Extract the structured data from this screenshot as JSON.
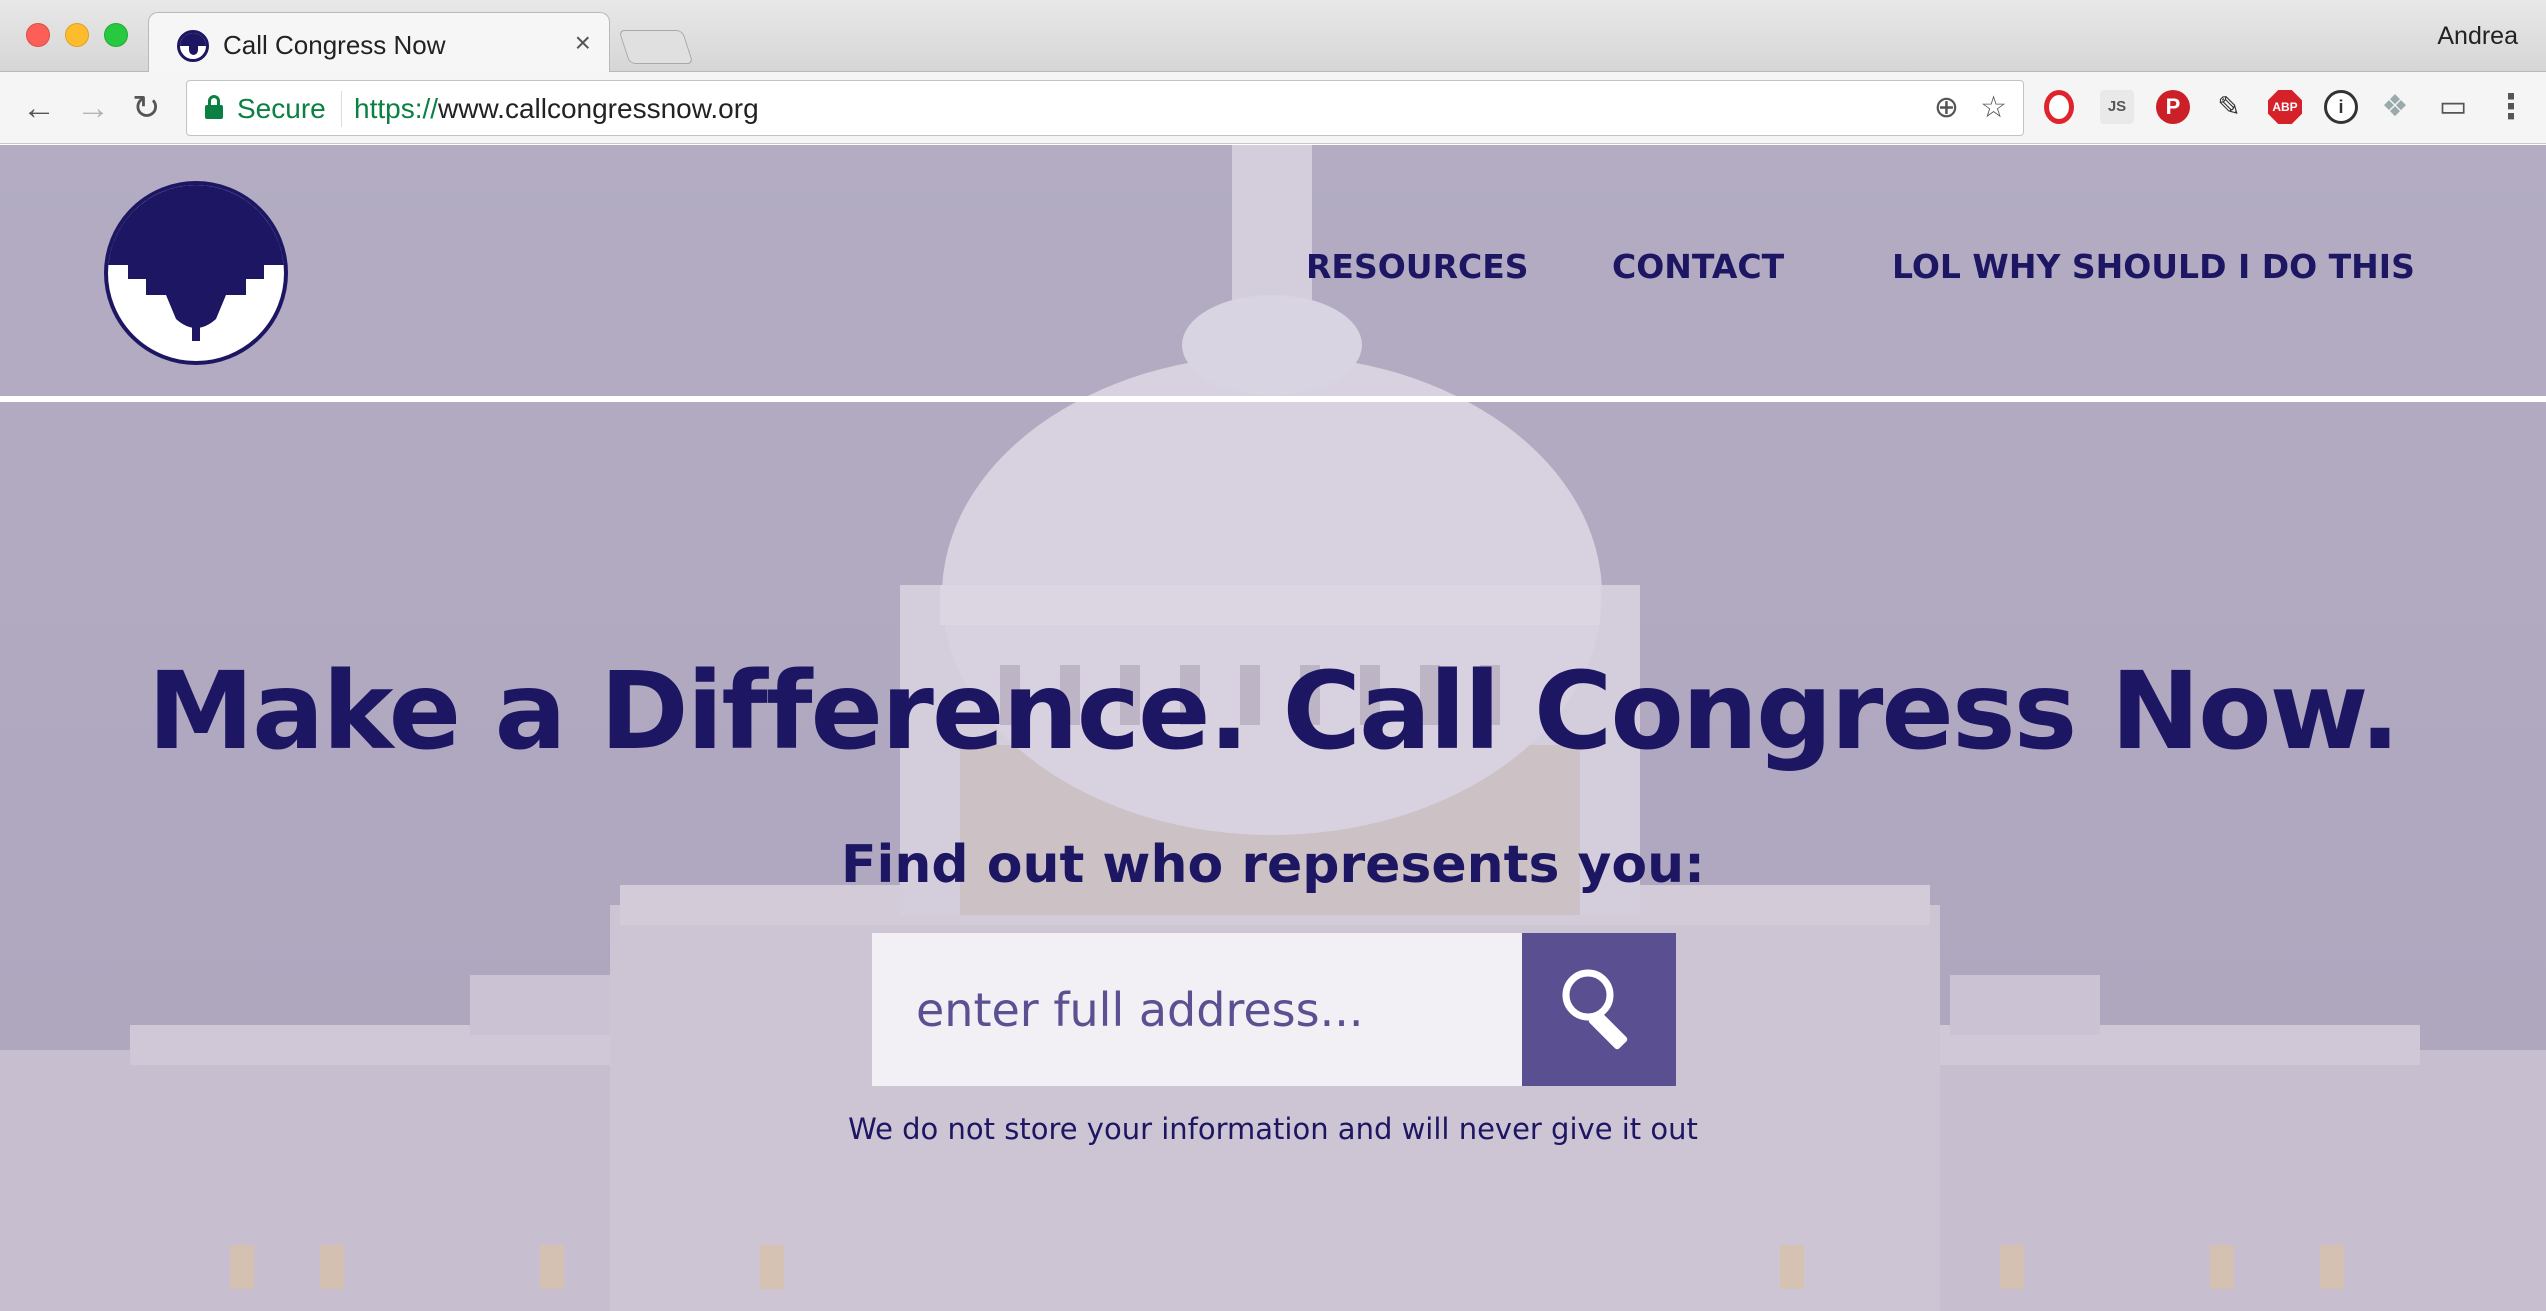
{
  "browser": {
    "tab_title": "Call Congress Now",
    "tab_close": "×",
    "profile_name": "Andrea",
    "secure_label": "Secure",
    "url_scheme": "https://",
    "url_rest": "www.callcongressnow.org",
    "icons": {
      "back": "back-arrow-icon",
      "forward": "forward-arrow-icon",
      "reload": "reload-icon",
      "zoom": "zoom-icon",
      "star": "bookmark-star-icon"
    },
    "extensions": [
      "opera-extension",
      "javascript-extension",
      "pinterest-extension",
      "eyedropper-extension",
      "adblock-plus-extension",
      "info-extension",
      "dropbox-extension",
      "cast-extension",
      "chrome-menu"
    ],
    "ext_labels": {
      "js": "JS",
      "pin": "P",
      "abp": "ABP",
      "info": "i"
    }
  },
  "site": {
    "nav": {
      "resources": "RESOURCES",
      "contact": "CONTACT",
      "why": "LOL WHY SHOULD I DO THIS"
    },
    "hero": {
      "headline": "Make a Difference. Call Congress Now.",
      "subhead": "Find out who represents you:",
      "search_placeholder": "enter full address...",
      "disclaimer": "We do not store your information and will never give it out"
    },
    "colors": {
      "brand_navy": "#1d1663",
      "button_purple": "#594f91"
    }
  }
}
